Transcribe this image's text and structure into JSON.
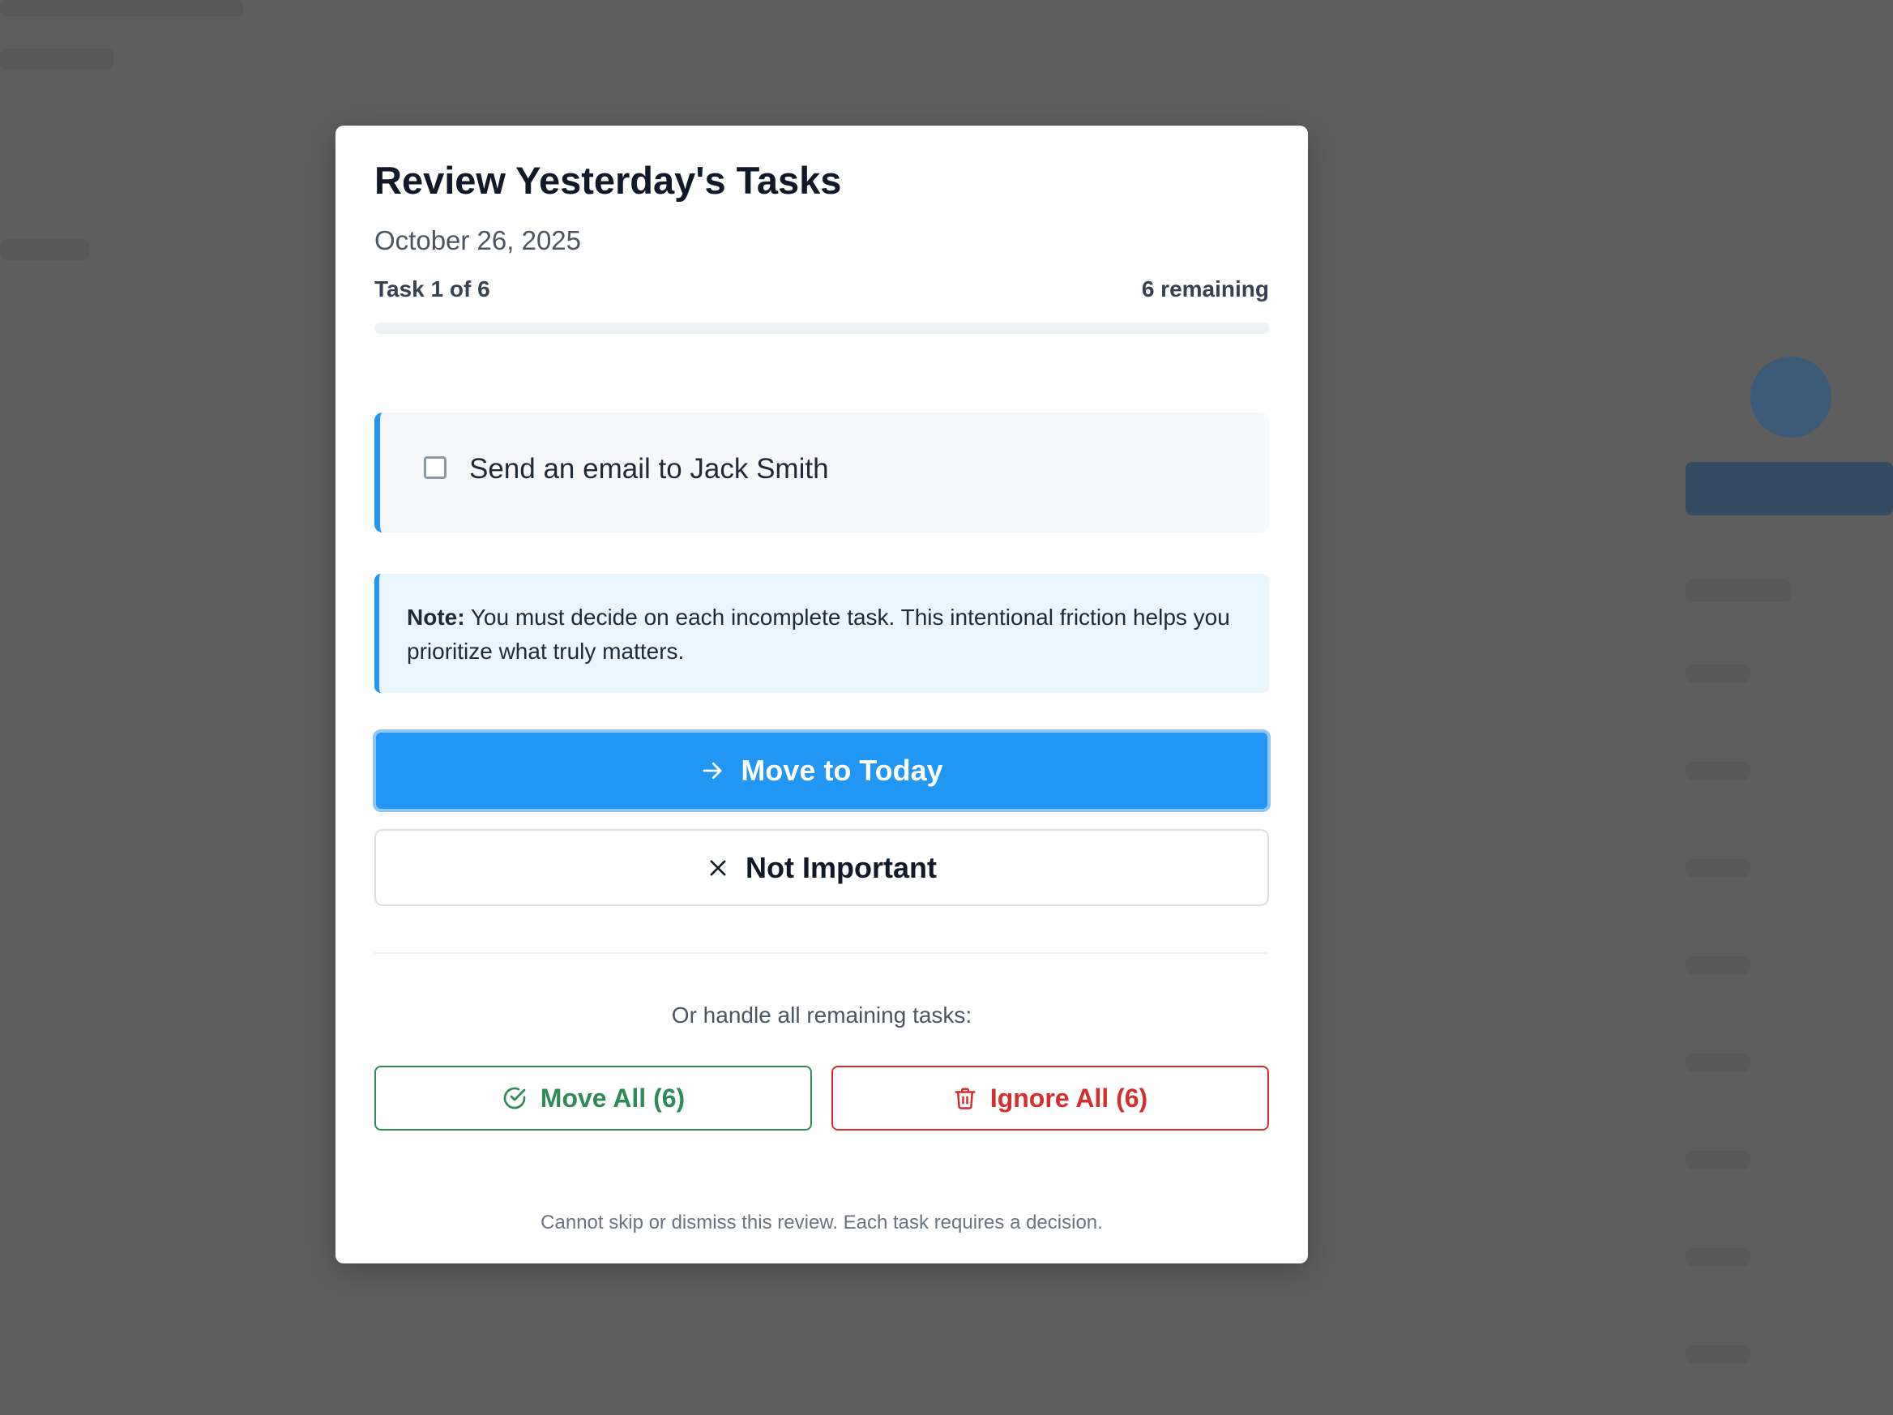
{
  "modal": {
    "title": "Review Yesterday's Tasks",
    "date": "October 26, 2025",
    "progress": {
      "label": "Task 1 of 6",
      "remaining": "6 remaining",
      "fraction": 0.0
    },
    "task": {
      "text": "Send an email to Jack Smith",
      "checked": false
    },
    "note": {
      "label": "Note:",
      "text": " You must decide on each incomplete task. This intentional friction helps you prioritize what truly matters."
    },
    "actions": {
      "primary_label": "Move to Today",
      "primary_icon": "arrow-right-icon",
      "secondary_label": "Not Important",
      "secondary_icon": "close-icon"
    },
    "bulk": {
      "prompt": "Or handle all remaining tasks:",
      "move_all_label": "Move All (6)",
      "move_all_icon": "check-circle-icon",
      "ignore_all_label": "Ignore All (6)",
      "ignore_all_icon": "trash-icon"
    },
    "footer": "Cannot skip or dismiss this review. Each task requires a decision."
  },
  "colors": {
    "accent": "#2196f3",
    "success": "#2e8b57",
    "danger": "#d32f2f",
    "backdrop": "#5e5e5e"
  }
}
